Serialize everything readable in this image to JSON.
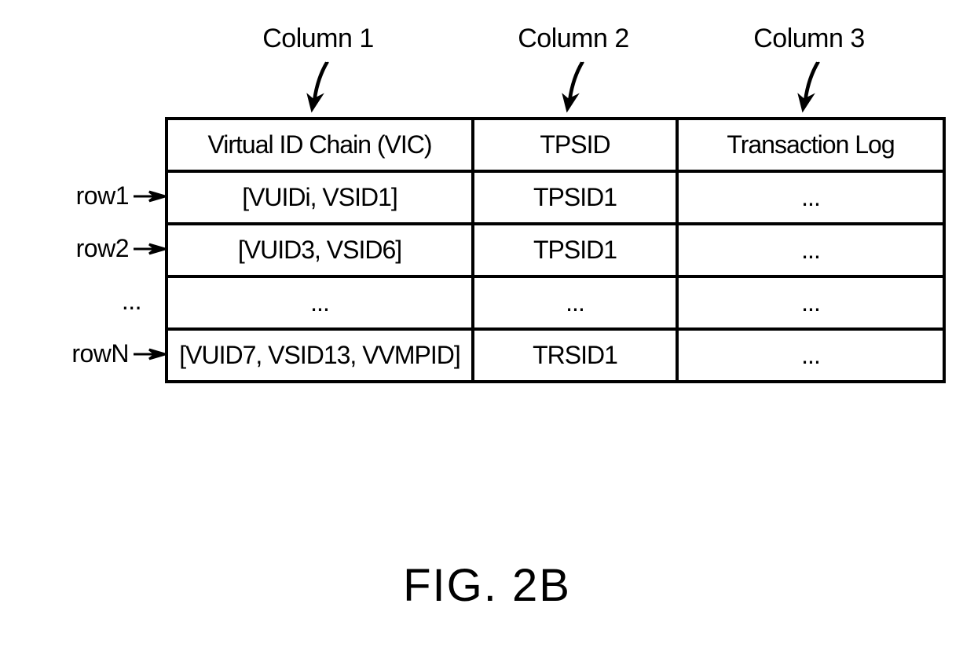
{
  "column_labels": [
    "Column 1",
    "Column 2",
    "Column 3"
  ],
  "row_labels": [
    "row1",
    "row2",
    "...",
    "rowN"
  ],
  "table": {
    "headers": [
      "Virtual ID Chain (VIC)",
      "TPSID",
      "Transaction Log"
    ],
    "rows": [
      [
        "[VUIDi, VSID1]",
        "TPSID1",
        "..."
      ],
      [
        "[VUID3, VSID6]",
        "TPSID1",
        "..."
      ],
      [
        "...",
        "...",
        "..."
      ],
      [
        "[VUID7, VSID13, VVMPID]",
        "TRSID1",
        "..."
      ]
    ]
  },
  "figure_caption": "FIG. 2B"
}
